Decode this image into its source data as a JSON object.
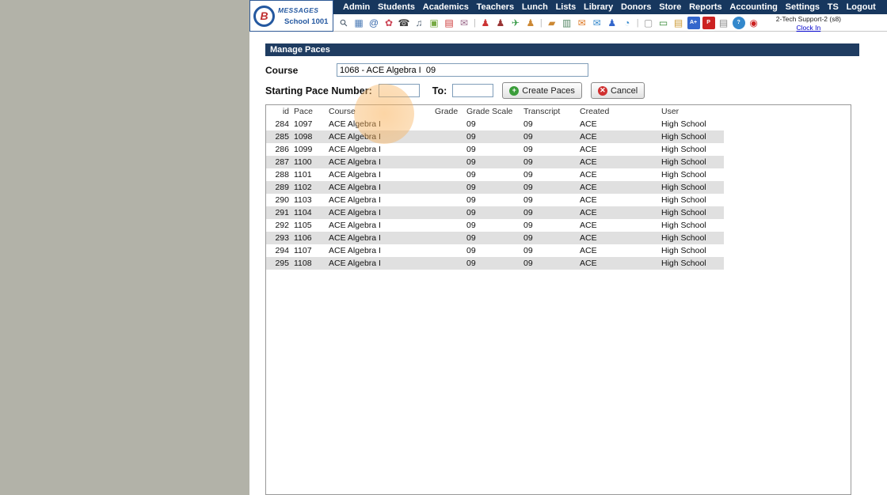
{
  "branding": {
    "logo_text": "MESSAGES",
    "school_label": "School 1001"
  },
  "nav": {
    "items": [
      "Admin",
      "Students",
      "Academics",
      "Teachers",
      "Lunch",
      "Lists",
      "Library",
      "Donors",
      "Store",
      "Reports",
      "Accounting",
      "Settings",
      "TS",
      "Logout"
    ]
  },
  "toolbar": {
    "icons": [
      {
        "name": "search-icon",
        "glyph": "⚲",
        "fg": "#445566"
      },
      {
        "name": "grid-icon",
        "glyph": "▦",
        "fg": "#4a7ab5"
      },
      {
        "name": "email-at-icon",
        "glyph": "@",
        "fg": "#3366aa"
      },
      {
        "name": "flower-icon",
        "glyph": "✿",
        "fg": "#cc4455"
      },
      {
        "name": "phone-icon",
        "glyph": "☎",
        "fg": "#444444"
      },
      {
        "name": "speaker-icon",
        "glyph": "♫",
        "fg": "#556677"
      },
      {
        "name": "photo-icon",
        "glyph": "▣",
        "fg": "#77aa44"
      },
      {
        "name": "calendar-red-icon",
        "glyph": "▤",
        "fg": "#cc3333"
      },
      {
        "name": "mail-reply-icon",
        "glyph": "✉",
        "fg": "#996688"
      },
      {
        "name": "toolbar-divider",
        "glyph": "|",
        "divider": true
      },
      {
        "name": "alarm-person-red-icon",
        "glyph": "♟",
        "fg": "#cc3333"
      },
      {
        "name": "person-darkred-icon",
        "glyph": "♟",
        "fg": "#993333"
      },
      {
        "name": "plane-green-icon",
        "glyph": "✈",
        "fg": "#339944"
      },
      {
        "name": "person-gold-icon",
        "glyph": "♟",
        "fg": "#cc8833"
      },
      {
        "name": "toolbar-divider",
        "glyph": "|",
        "divider": true
      },
      {
        "name": "briefcase-orange-icon",
        "glyph": "▰",
        "fg": "#cc8833"
      },
      {
        "name": "notebook-icon",
        "glyph": "▥",
        "fg": "#558866"
      },
      {
        "name": "envelope-orange-icon",
        "glyph": "✉",
        "fg": "#dd7722"
      },
      {
        "name": "mail-send-blue-icon",
        "glyph": "✉",
        "fg": "#3388cc"
      },
      {
        "name": "person-blue-icon",
        "glyph": "♟",
        "fg": "#3366cc"
      },
      {
        "name": "clock-blue-icon",
        "glyph": "◔",
        "fg": "#3388cc"
      },
      {
        "name": "toolbar-divider",
        "glyph": "|",
        "divider": true
      },
      {
        "name": "window-gray-icon",
        "glyph": "▢",
        "fg": "#999999"
      },
      {
        "name": "card-green-icon",
        "glyph": "▭",
        "fg": "#338833"
      },
      {
        "name": "folder-icon",
        "glyph": "▤",
        "fg": "#cc9933"
      },
      {
        "name": "grade-aplus-icon",
        "glyph": "A+",
        "fg": "#ffffff",
        "bg": "#3366cc",
        "small": true
      },
      {
        "name": "pdf-icon",
        "glyph": "P",
        "fg": "#ffffff",
        "bg": "#cc2222",
        "small": true
      },
      {
        "name": "printer-icon",
        "glyph": "▤",
        "fg": "#888888"
      },
      {
        "name": "help-icon",
        "glyph": "?",
        "fg": "#ffffff",
        "bg": "#3388cc",
        "round": true,
        "small": true
      },
      {
        "name": "power-icon",
        "glyph": "◉",
        "fg": "#cc2222"
      }
    ]
  },
  "user_panel": {
    "user_label": "2-Tech Support-2 (s8)",
    "clock_in_label": "Clock In"
  },
  "page": {
    "title": "Manage Paces"
  },
  "form": {
    "course_label": "Course",
    "course_value": "1068 - ACE Algebra I  09",
    "starting_pace_label": "Starting Pace Number:",
    "starting_pace_value": "",
    "to_label": "To:",
    "to_value": "",
    "create_paces_label": "Create Paces",
    "cancel_label": "Cancel"
  },
  "table": {
    "headers": [
      "id",
      "Pace",
      "Course",
      "Grade",
      "Grade Scale",
      "Transcript",
      "Created",
      "User"
    ],
    "rows": [
      [
        "284",
        "1097",
        "ACE Algebra I",
        "",
        "09",
        "09",
        "ACE",
        "High School"
      ],
      [
        "285",
        "1098",
        "ACE Algebra I",
        "",
        "09",
        "09",
        "ACE",
        "High School"
      ],
      [
        "286",
        "1099",
        "ACE Algebra I",
        "",
        "09",
        "09",
        "ACE",
        "High School"
      ],
      [
        "287",
        "1100",
        "ACE Algebra I",
        "",
        "09",
        "09",
        "ACE",
        "High School"
      ],
      [
        "288",
        "1101",
        "ACE Algebra I",
        "",
        "09",
        "09",
        "ACE",
        "High School"
      ],
      [
        "289",
        "1102",
        "ACE Algebra I",
        "",
        "09",
        "09",
        "ACE",
        "High School"
      ],
      [
        "290",
        "1103",
        "ACE Algebra I",
        "",
        "09",
        "09",
        "ACE",
        "High School"
      ],
      [
        "291",
        "1104",
        "ACE Algebra I",
        "",
        "09",
        "09",
        "ACE",
        "High School"
      ],
      [
        "292",
        "1105",
        "ACE Algebra I",
        "",
        "09",
        "09",
        "ACE",
        "High School"
      ],
      [
        "293",
        "1106",
        "ACE Algebra I",
        "",
        "09",
        "09",
        "ACE",
        "High School"
      ],
      [
        "294",
        "1107",
        "ACE Algebra I",
        "",
        "09",
        "09",
        "ACE",
        "High School"
      ],
      [
        "295",
        "1108",
        "ACE Algebra I",
        "",
        "09",
        "09",
        "ACE",
        "High School"
      ]
    ]
  },
  "colors": {
    "nav_bg": "#17375e",
    "title_bg": "#1f3c61",
    "alt_row": "#e0e0e0",
    "link_blue": "#0000cc",
    "left_background": "#b2b2a8",
    "highlight_orange": "rgba(249,178,91,0.5)"
  }
}
